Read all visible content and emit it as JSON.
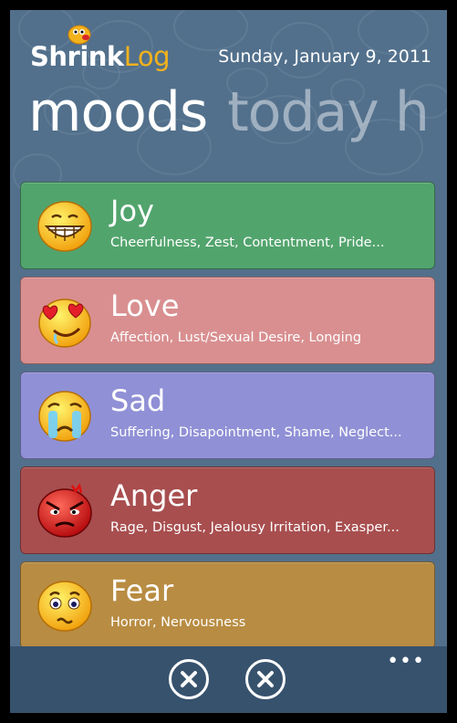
{
  "app": {
    "name_part1": "Shrink",
    "name_part2": "Log"
  },
  "header": {
    "date": "Sunday, January 9, 2011"
  },
  "pivot": {
    "active": "moods",
    "next": "today h"
  },
  "moods": [
    {
      "name": "Joy",
      "subtitle": "Cheerfulness, Zest, Contentment, Pride...",
      "color": "#52a46d",
      "icon": "grinning-face-icon"
    },
    {
      "name": "Love",
      "subtitle": "Affection, Lust/Sexual Desire, Longing",
      "color": "#d98f90",
      "icon": "heart-eyes-face-icon"
    },
    {
      "name": "Sad",
      "subtitle": "Suffering, Disapointment, Shame, Neglect...",
      "color": "#9090d6",
      "icon": "crying-face-icon"
    },
    {
      "name": "Anger",
      "subtitle": "Rage, Disgust, Jealousy Irritation, Exasper...",
      "color": "#a84e4f",
      "icon": "angry-face-icon"
    },
    {
      "name": "Fear",
      "subtitle": "Horror, Nervousness",
      "color": "#b88c42",
      "icon": "worried-face-icon"
    }
  ],
  "appbar": {
    "more": "•••",
    "buttons": [
      "cancel-icon",
      "cancel-icon"
    ]
  }
}
